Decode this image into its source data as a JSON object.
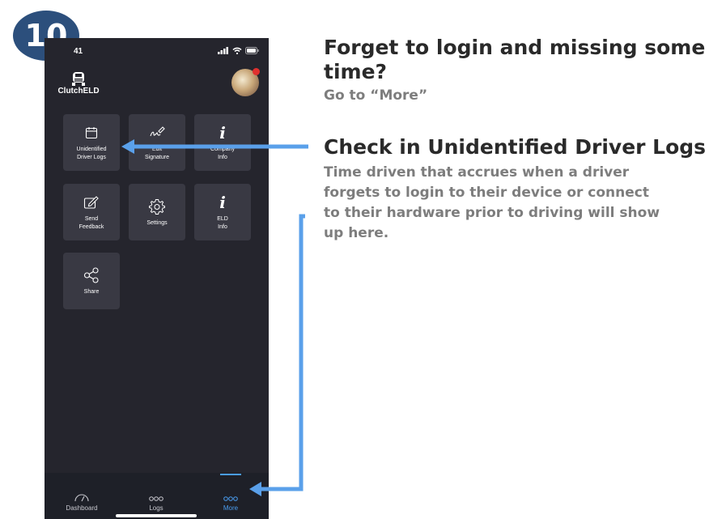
{
  "step_badge": "10",
  "status_bar": {
    "time": "41"
  },
  "app": {
    "logo_text": "ClutchELD"
  },
  "tiles": [
    {
      "label": "Unidentified\nDriver Logs",
      "icon": "calendar-icon"
    },
    {
      "label": "Edit\nSignature",
      "icon": "signature-pen-icon"
    },
    {
      "label": "Company\nInfo",
      "icon": "info-icon"
    },
    {
      "label": "Send\nFeedback",
      "icon": "feedback-edit-icon"
    },
    {
      "label": "Settings",
      "icon": "gear-icon"
    },
    {
      "label": "ELD\nInfo",
      "icon": "info-icon"
    },
    {
      "label": "Share",
      "icon": "share-icon"
    }
  ],
  "tabbar": [
    {
      "label": "Dashboard",
      "icon": "speedometer-icon",
      "active": false
    },
    {
      "label": "Logs",
      "icon": "dots-icon",
      "active": false
    },
    {
      "label": "More",
      "icon": "dots-icon",
      "active": true
    }
  ],
  "callouts": {
    "more": {
      "title_line1": "Forget to login and missing some",
      "title_line2": "time?",
      "subtitle": "Go to “More”"
    },
    "unidentified": {
      "title": "Check in Unidentified Driver Logs",
      "body_line1": "Time driven that accrues when a driver",
      "body_line2": "forgets to login to their device or connect",
      "body_line3": "to their hardware prior to driving will show",
      "body_line4": "up here."
    }
  },
  "colors": {
    "badge": "#2c4f7c",
    "arrow": "#5aa0ea",
    "active_tab": "#4a9df0",
    "screen_bg": "#25252d",
    "tile_bg": "#393943"
  }
}
